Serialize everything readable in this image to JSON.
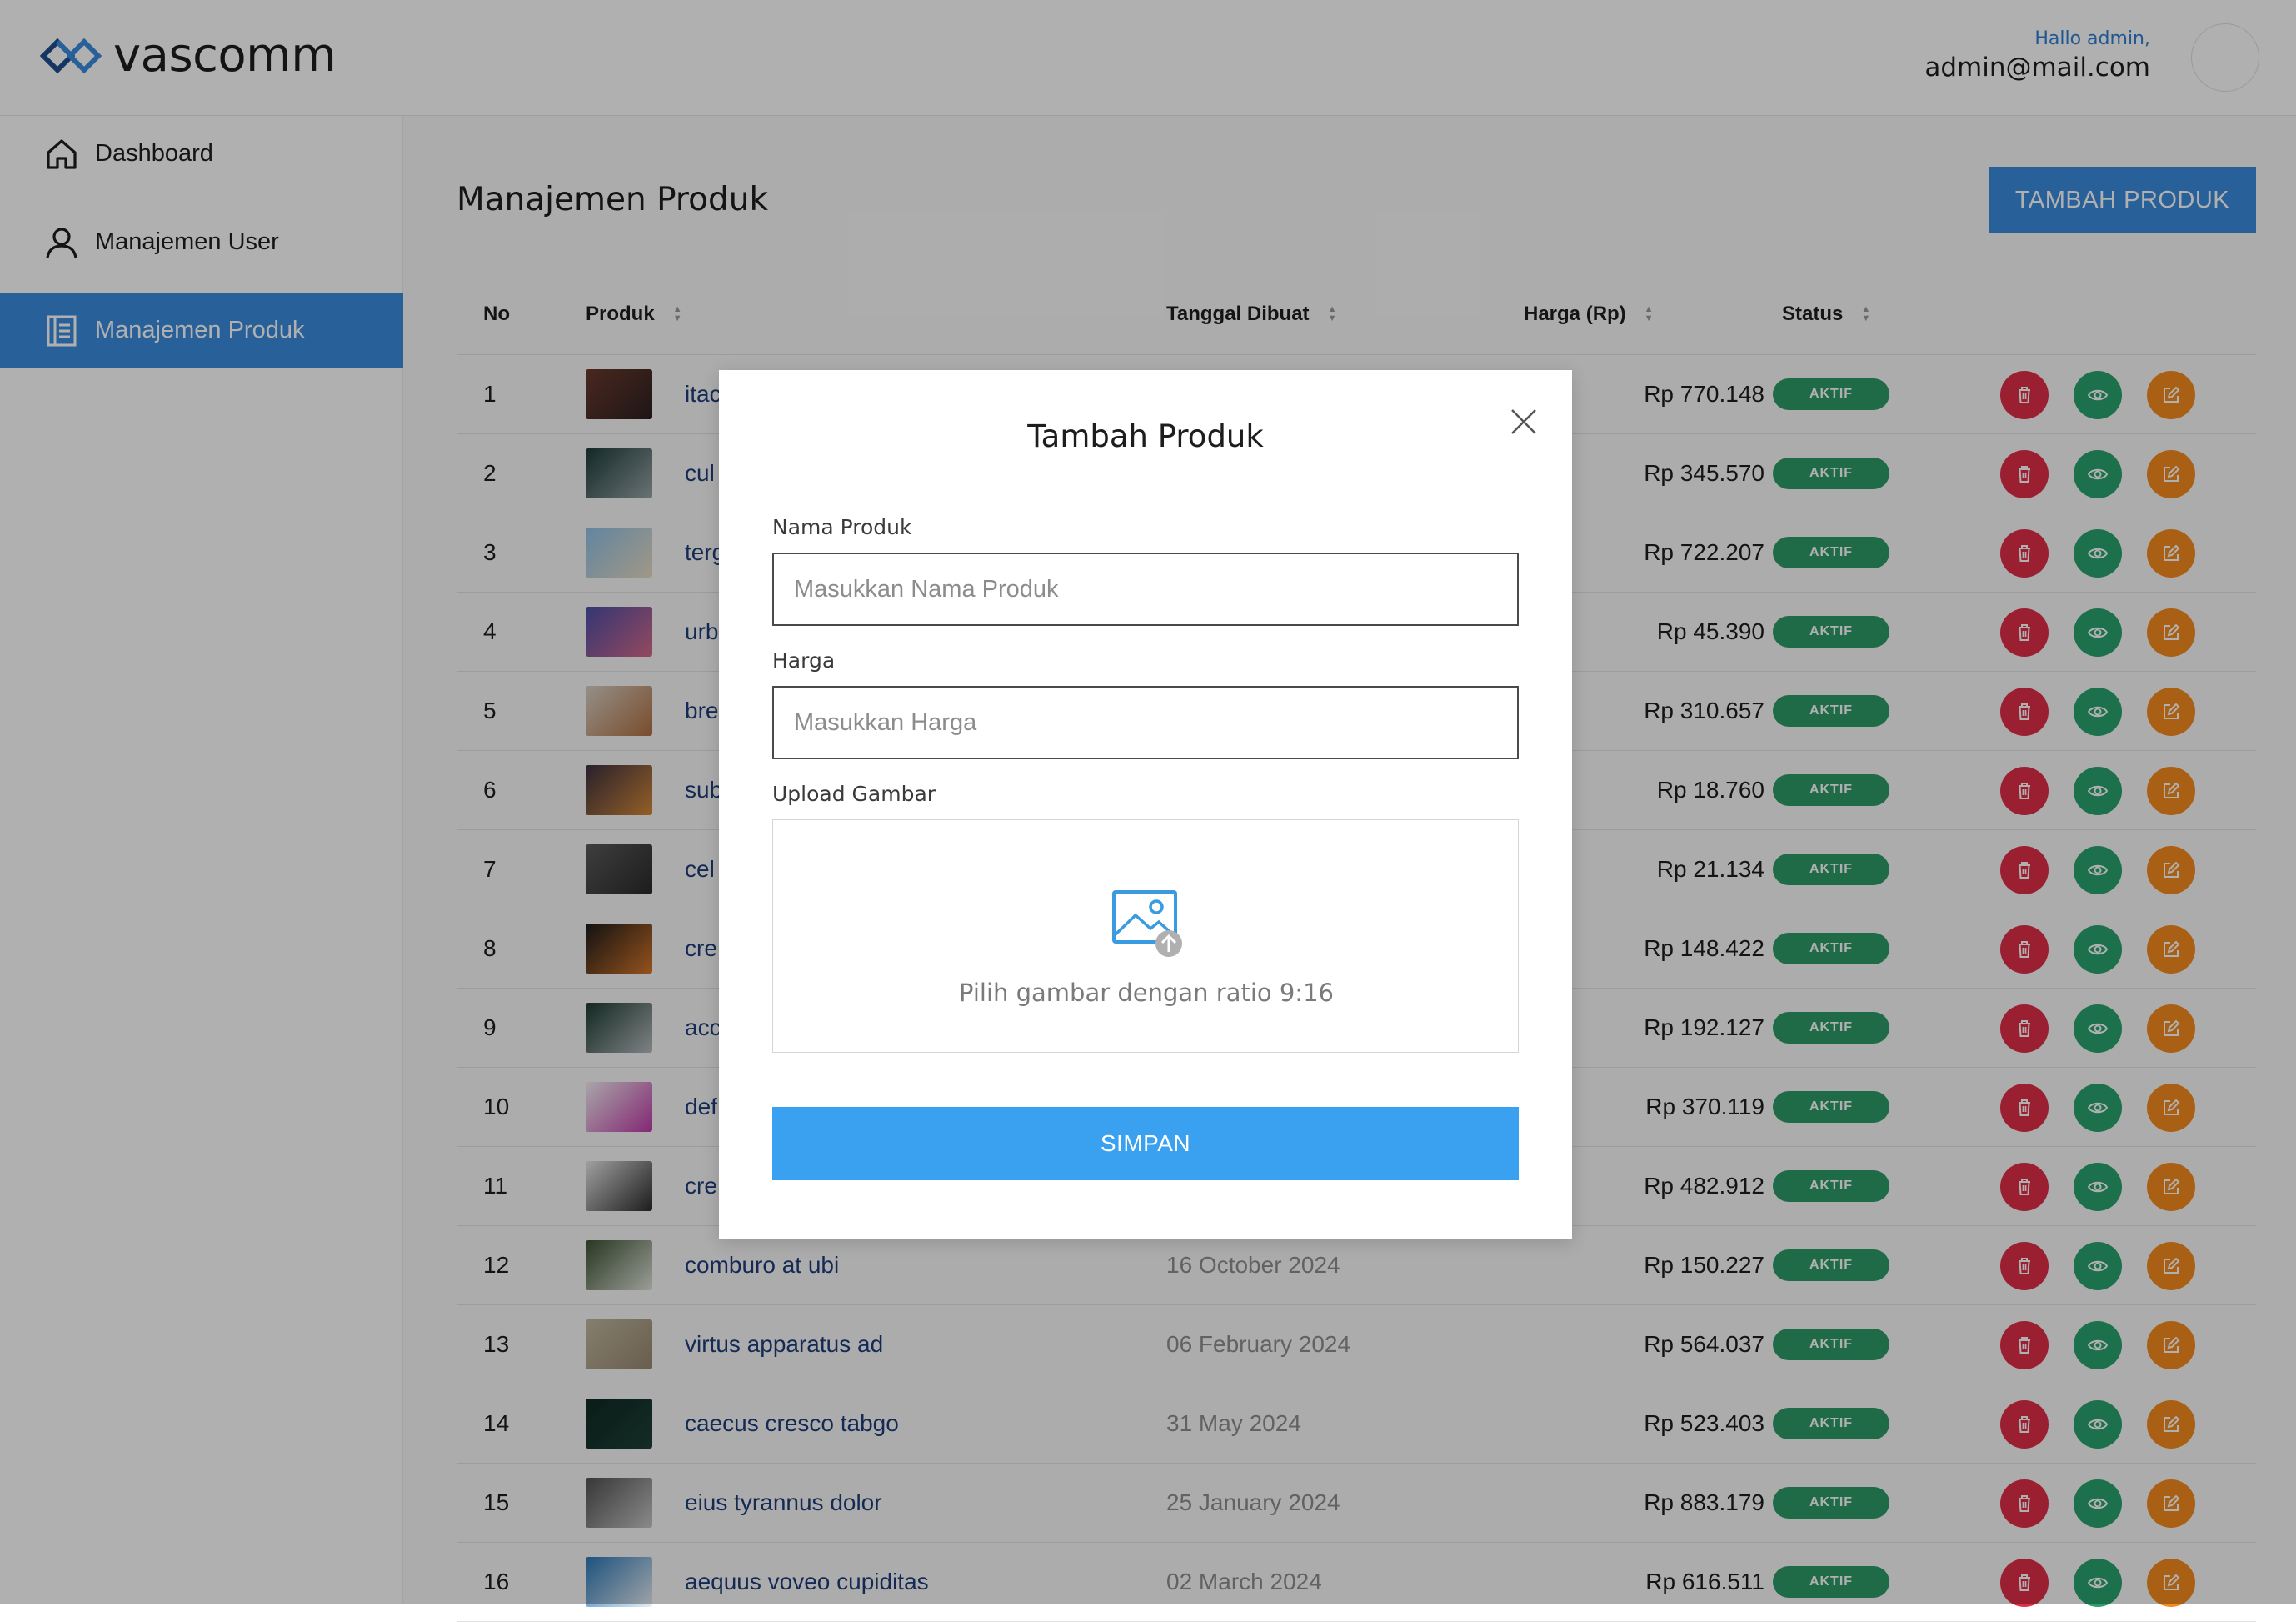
{
  "brand": {
    "name": "vascomm"
  },
  "user": {
    "greeting": "Hallo admin,",
    "email": "admin@mail.com"
  },
  "sidebar": {
    "items": [
      {
        "label": "Dashboard",
        "icon": "home-icon",
        "active": false
      },
      {
        "label": "Manajemen User",
        "icon": "user-icon",
        "active": false
      },
      {
        "label": "Manajemen Produk",
        "icon": "document-icon",
        "active": true
      }
    ]
  },
  "main": {
    "title": "Manajemen Produk",
    "add_button": "TAMBAH PRODUK",
    "columns": {
      "no": "No",
      "product": "Produk",
      "date": "Tanggal Dibuat",
      "price": "Harga (Rp)",
      "status": "Status"
    },
    "rows": [
      {
        "no": "1",
        "name": "itac",
        "date": "",
        "price": "Rp 770.148",
        "status": "AKTIF",
        "thumb": [
          "#6b3a2e",
          "#2c2020"
        ]
      },
      {
        "no": "2",
        "name": "cul",
        "date": "",
        "price": "Rp 345.570",
        "status": "AKTIF",
        "thumb": [
          "#1d3a3a",
          "#9aa6a8"
        ]
      },
      {
        "no": "3",
        "name": "terg",
        "date": "",
        "price": "Rp 722.207",
        "status": "AKTIF",
        "thumb": [
          "#8fc1e8",
          "#e8dcc4"
        ]
      },
      {
        "no": "4",
        "name": "urb",
        "date": "",
        "price": "Rp 45.390",
        "status": "AKTIF",
        "thumb": [
          "#4a4ea8",
          "#d86a8a"
        ]
      },
      {
        "no": "5",
        "name": "bre",
        "date": "",
        "price": "Rp 310.657",
        "status": "AKTIF",
        "thumb": [
          "#d8d0c4",
          "#b07040"
        ]
      },
      {
        "no": "6",
        "name": "sub",
        "date": "",
        "price": "Rp 18.760",
        "status": "AKTIF",
        "thumb": [
          "#3a3040",
          "#d88a3a"
        ]
      },
      {
        "no": "7",
        "name": "cel",
        "date": "",
        "price": "Rp 21.134",
        "status": "AKTIF",
        "thumb": [
          "#5a5a5a",
          "#2a2a2a"
        ]
      },
      {
        "no": "8",
        "name": "cre",
        "date": "",
        "price": "Rp 148.422",
        "status": "AKTIF",
        "thumb": [
          "#1a1a1a",
          "#d8782a"
        ]
      },
      {
        "no": "9",
        "name": "acc",
        "date": "",
        "price": "Rp 192.127",
        "status": "AKTIF",
        "thumb": [
          "#1a3a30",
          "#b8bcc0"
        ]
      },
      {
        "no": "10",
        "name": "def",
        "date": "",
        "price": "Rp 370.119",
        "status": "AKTIF",
        "thumb": [
          "#f4f0f4",
          "#c03aa8"
        ]
      },
      {
        "no": "11",
        "name": "cre",
        "date": "",
        "price": "Rp 482.912",
        "status": "AKTIF",
        "thumb": [
          "#e8e8e8",
          "#2a2a2a"
        ]
      },
      {
        "no": "12",
        "name": "comburo at ubi",
        "date": "16 October 2024",
        "price": "Rp 150.227",
        "status": "AKTIF",
        "thumb": [
          "#3a5030",
          "#e0e4dc"
        ]
      },
      {
        "no": "13",
        "name": "virtus apparatus ad",
        "date": "06 February 2024",
        "price": "Rp 564.037",
        "status": "AKTIF",
        "thumb": [
          "#c0b8a0",
          "#9a8870"
        ]
      },
      {
        "no": "14",
        "name": "caecus cresco tabgo",
        "date": "31 May 2024",
        "price": "Rp 523.403",
        "status": "AKTIF",
        "thumb": [
          "#0e2a24",
          "#1e4038"
        ]
      },
      {
        "no": "15",
        "name": "eius tyrannus dolor",
        "date": "25 January 2024",
        "price": "Rp 883.179",
        "status": "AKTIF",
        "thumb": [
          "#505050",
          "#c8c8c8"
        ]
      },
      {
        "no": "16",
        "name": "aequus voveo cupiditas",
        "date": "02 March 2024",
        "price": "Rp 616.511",
        "status": "AKTIF",
        "thumb": [
          "#2a78b8",
          "#e8eef4"
        ]
      }
    ]
  },
  "modal": {
    "title": "Tambah Produk",
    "name_label": "Nama Produk",
    "name_placeholder": "Masukkan Nama Produk",
    "price_label": "Harga",
    "price_placeholder": "Masukkan Harga",
    "upload_label": "Upload Gambar",
    "upload_hint": "Pilih gambar dengan ratio 9:16",
    "save_button": "SIMPAN"
  },
  "colors": {
    "primary": "#3a8be0",
    "status_active": "#2e9b68",
    "delete": "#e02f48",
    "view": "#29a26e",
    "edit": "#f58c1f",
    "save": "#3aa0f0"
  }
}
